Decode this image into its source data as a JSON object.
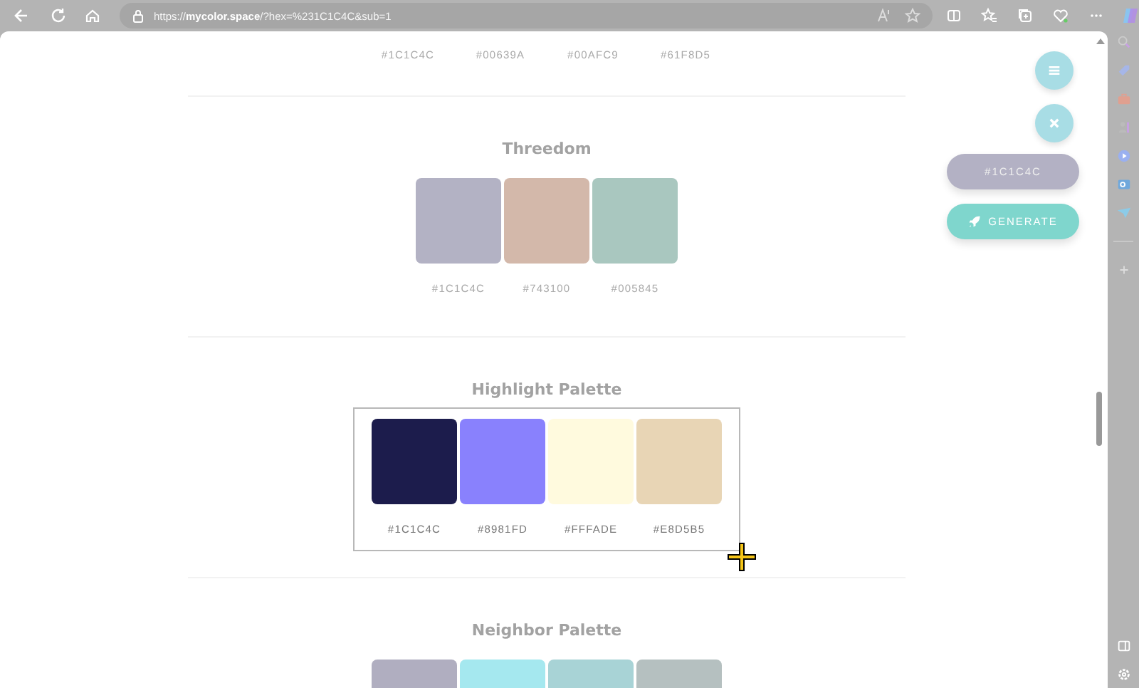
{
  "browser": {
    "url": "https://**mycolor.space**/?hex=%231C1C4C&sub=1"
  },
  "top_palette": {
    "hex_codes": [
      "#1C1C4C",
      "#00639A",
      "#00AFC9",
      "#61F8D5"
    ]
  },
  "palettes": [
    {
      "title": "Threedom",
      "selected": false,
      "swatches": [
        {
          "hex": "#1C1C4C",
          "color": "#b3b2c4"
        },
        {
          "hex": "#743100",
          "color": "#d3b8aa"
        },
        {
          "hex": "#005845",
          "color": "#a9c7bf"
        }
      ]
    },
    {
      "title": "Highlight Palette",
      "selected": true,
      "swatches": [
        {
          "hex": "#1C1C4C",
          "color": "#1c1c4c"
        },
        {
          "hex": "#8981FD",
          "color": "#8981fd"
        },
        {
          "hex": "#FFFADE",
          "color": "#fffade"
        },
        {
          "hex": "#E8D5B5",
          "color": "#e8d5b5"
        }
      ]
    },
    {
      "title": "Neighbor Palette",
      "selected": false,
      "swatches": [
        {
          "color": "#b0aec0"
        },
        {
          "color": "#a5e8ef"
        },
        {
          "color": "#a8d3d6"
        },
        {
          "color": "#b5c0c0"
        }
      ]
    }
  ],
  "actions": {
    "hex_button": "#1C1C4C",
    "generate_button": "GENERATE"
  }
}
